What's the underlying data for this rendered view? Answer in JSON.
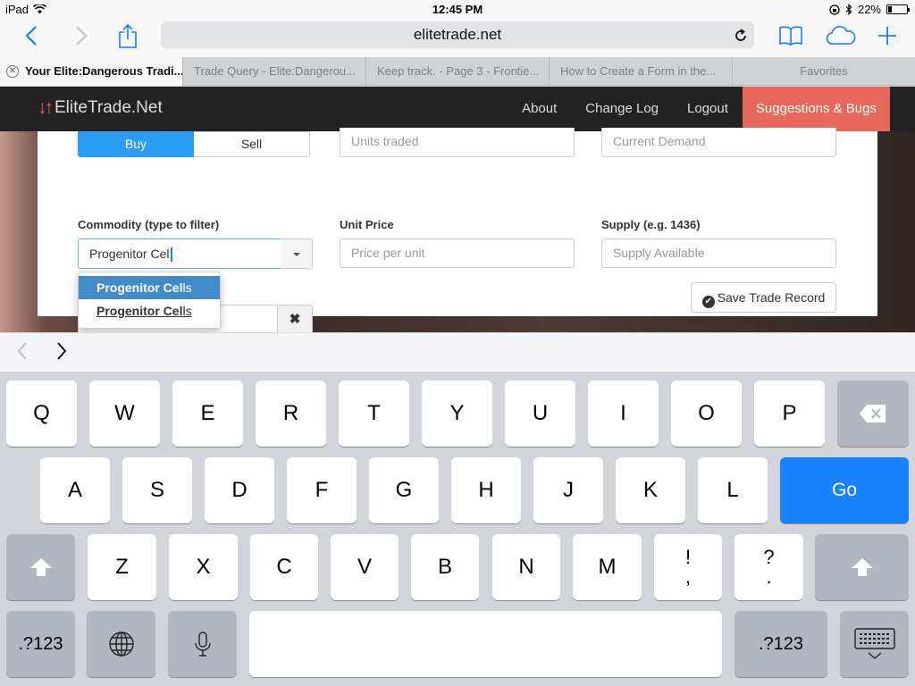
{
  "status": {
    "device": "iPad",
    "time": "12:45 PM",
    "battery": "22%",
    "battery_level": 0.22
  },
  "browser": {
    "url": "elitetrade.net",
    "tabs": [
      {
        "label": "Your Elite:Dangerous Tradi..."
      },
      {
        "label": "Trade Query - Elite:Dangerou..."
      },
      {
        "label": "Keep track. - Page 3 - Frontie..."
      },
      {
        "label": "How to Create a Form in the..."
      }
    ],
    "favorites_label": "Favorites"
  },
  "site": {
    "brand": "EliteTrade.Net",
    "nav": [
      "About",
      "Change Log",
      "Logout",
      "Suggestions & Bugs"
    ],
    "accent_color": "#e8675b"
  },
  "form": {
    "buy_label": "Buy",
    "sell_label": "Sell",
    "units_placeholder": "Units traded",
    "demand_placeholder": "Current Demand",
    "commodity_label": "Commodity (type to filter)",
    "commodity_value": "Progenitor Cel",
    "unit_price_label": "Unit Price",
    "price_placeholder": "Price per unit",
    "supply_label": "Supply (e.g. 1436)",
    "supply_placeholder": "Supply Available",
    "save_label": "Save Trade Record",
    "clear_symbol": "✖",
    "suggestions": [
      {
        "match": "Progenitor Cel",
        "rest": "ls"
      },
      {
        "match": "Progenitor Cel",
        "rest": "ls"
      }
    ]
  },
  "keyboard": {
    "row1": [
      "Q",
      "W",
      "E",
      "R",
      "T",
      "Y",
      "U",
      "I",
      "O",
      "P"
    ],
    "row2": [
      "A",
      "S",
      "D",
      "F",
      "G",
      "H",
      "J",
      "K",
      "L"
    ],
    "row3": [
      "Z",
      "X",
      "C",
      "V",
      "B",
      "N",
      "M"
    ],
    "punct1": [
      "!",
      ","
    ],
    "punct2": [
      "?",
      "."
    ],
    "go_label": "Go",
    "numbers_label": ".?123"
  }
}
